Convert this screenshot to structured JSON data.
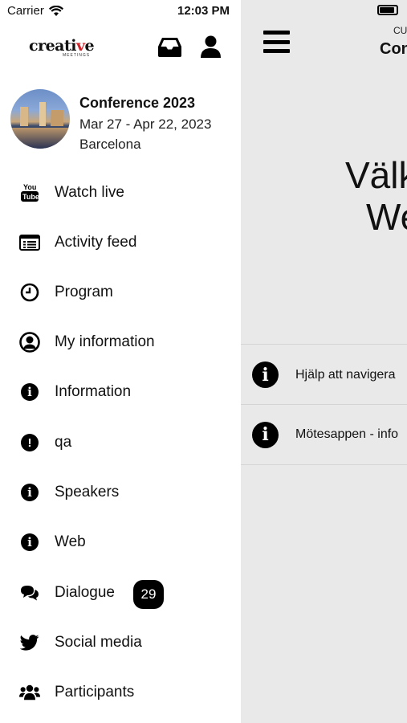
{
  "status_bar": {
    "carrier": "Carrier",
    "time": "12:03 PM"
  },
  "header": {
    "logo_text_1": "creati",
    "logo_text_2": "v",
    "logo_text_3": "e",
    "logo_sub": "MEETINGS"
  },
  "event": {
    "title": "Conference 2023",
    "dates": "Mar 27 - Apr 22, 2023",
    "city": "Barcelona"
  },
  "menu": [
    {
      "label": "Watch live",
      "icon": "youtube-icon"
    },
    {
      "label": "Activity feed",
      "icon": "list-icon"
    },
    {
      "label": "Program",
      "icon": "clock-icon"
    },
    {
      "label": "My information",
      "icon": "user-circle-icon"
    },
    {
      "label": "Information",
      "icon": "info-icon"
    },
    {
      "label": "qa",
      "icon": "exclamation-icon"
    },
    {
      "label": "Speakers",
      "icon": "info-icon"
    },
    {
      "label": "Web",
      "icon": "info-icon"
    },
    {
      "label": "Dialogue",
      "icon": "chat-icon",
      "badge": "29"
    },
    {
      "label": "Social media",
      "icon": "twitter-icon"
    },
    {
      "label": "Participants",
      "icon": "users-icon"
    }
  ],
  "main": {
    "subtitle": "CU",
    "title": "Con",
    "welcome_line1": "Välk",
    "welcome_line2": "We",
    "info_rows": [
      {
        "label": "Hjälp att navigera"
      },
      {
        "label": "Mötesappen - info"
      }
    ]
  }
}
